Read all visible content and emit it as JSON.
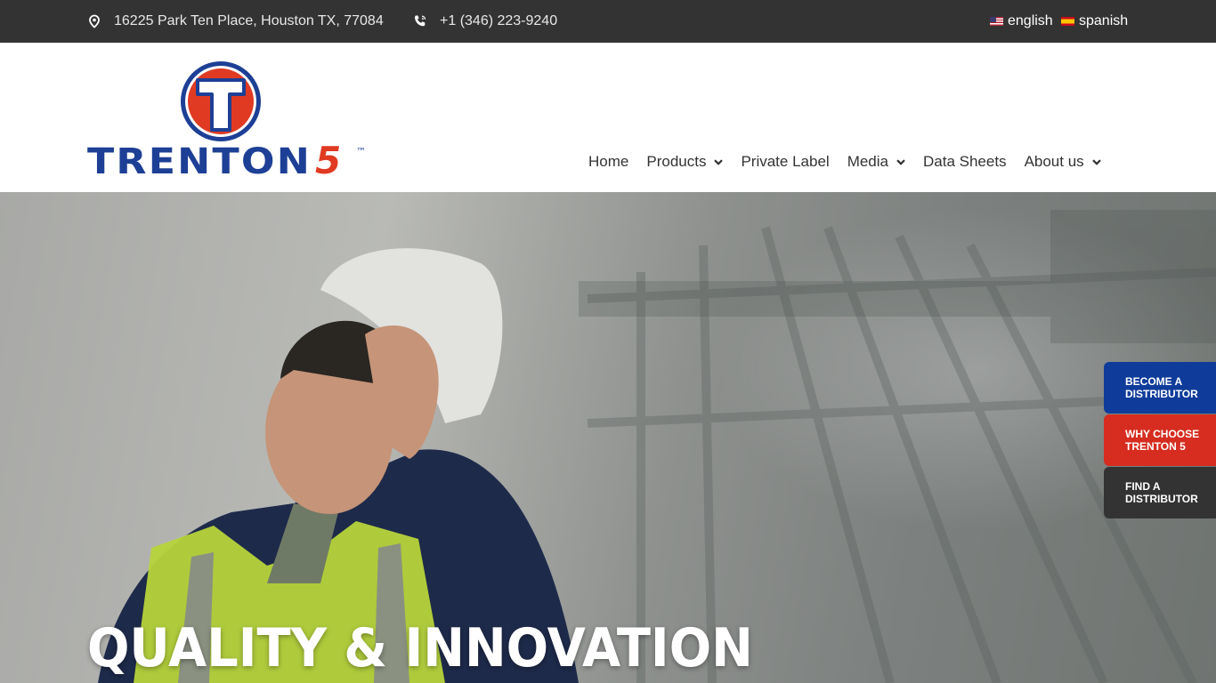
{
  "topbar": {
    "address": "16225 Park Ten Place, Houston TX, 77084",
    "address_icon": "location-pin-icon",
    "phone": "+1 (346) 223-9240",
    "phone_icon": "phone-icon",
    "languages": [
      {
        "label": "english",
        "flag": "us-flag-icon"
      },
      {
        "label": "spanish",
        "flag": "spain-flag-icon"
      }
    ]
  },
  "logo": {
    "text": "TRENTON",
    "digit": "5",
    "tm": "™",
    "emblem_letter": "T"
  },
  "nav": {
    "items": [
      {
        "label": "Home",
        "dropdown": false
      },
      {
        "label": "Products",
        "dropdown": true
      },
      {
        "label": "Private Label",
        "dropdown": false
      },
      {
        "label": "Media",
        "dropdown": true
      },
      {
        "label": "Data Sheets",
        "dropdown": false
      },
      {
        "label": "About us",
        "dropdown": true
      }
    ]
  },
  "hero": {
    "headline": "QUALITY & INNOVATION"
  },
  "side_tabs": [
    {
      "label": "BECOME A DISTRIBUTOR",
      "color": "#0f3c9a"
    },
    {
      "label": "WHY CHOOSE TRENTON 5",
      "color": "#d62d20"
    },
    {
      "label": "FIND A DISTRIBUTOR",
      "color": "#333333"
    }
  ],
  "colors": {
    "brand_blue": "#1d3f95",
    "brand_red": "#e03a23",
    "topbar_bg": "#333333"
  }
}
